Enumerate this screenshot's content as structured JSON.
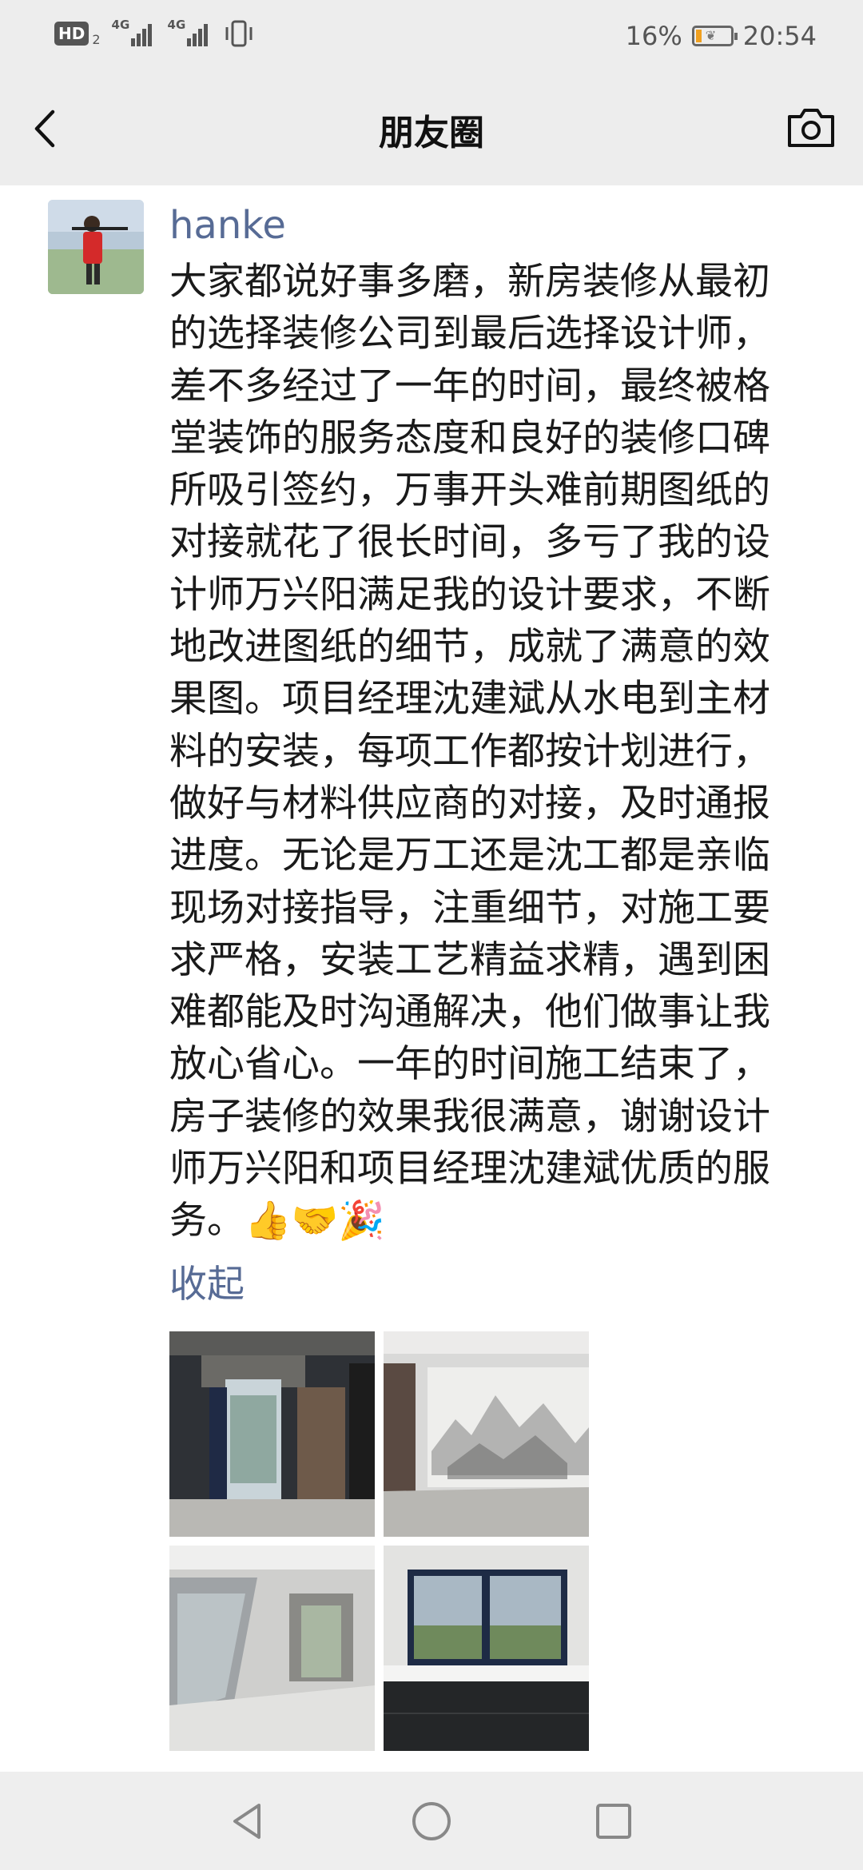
{
  "status_bar": {
    "hd": "HD",
    "hd_sub": "2",
    "net1": "4G",
    "net2": "4G",
    "battery_percent": "16%",
    "time": "20:54",
    "battery_level": 0.16
  },
  "nav": {
    "title": "朋友圈",
    "back_icon": "chevron-left",
    "camera_icon": "camera"
  },
  "post": {
    "username": "hanke",
    "text": "大家都说好事多磨，新房装修从最初\n的选择装修公司到最后选择设计师，\n差不多经过了一年的时间，最终被格\n堂装饰的服务态度和良好的装修口碑\n所吸引签约，万事开头难前期图纸的\n对接就花了很长时间，多亏了我的设\n计师万兴阳满足我的设计要求，不断\n地改进图纸的细节，成就了满意的效\n果图。项目经理沈建斌从水电到主材\n料的安装，每项工作都按计划进行，\n做好与材料供应商的对接，及时通报\n进度。无论是万工还是沈工都是亲临\n现场对接指导，注重细节，对施工要\n求严格，安装工艺精益求精，遇到困\n难都能及时沟通解决，他们做事让我\n放心省心。一年的时间施工结束了，\n房子装修的效果我很满意，谢谢设计\n师万兴阳和项目经理沈建斌优质的服\n务。👍🤝🎉",
    "collapse_label": "收起",
    "photos": [
      "entrance-hall-photo",
      "marble-wall-living-room-photo",
      "staircase-living-room-photo",
      "kitchen-window-photo"
    ]
  },
  "bottom_nav": {
    "icons": [
      "back-triangle",
      "home-circle",
      "recents-square"
    ]
  }
}
